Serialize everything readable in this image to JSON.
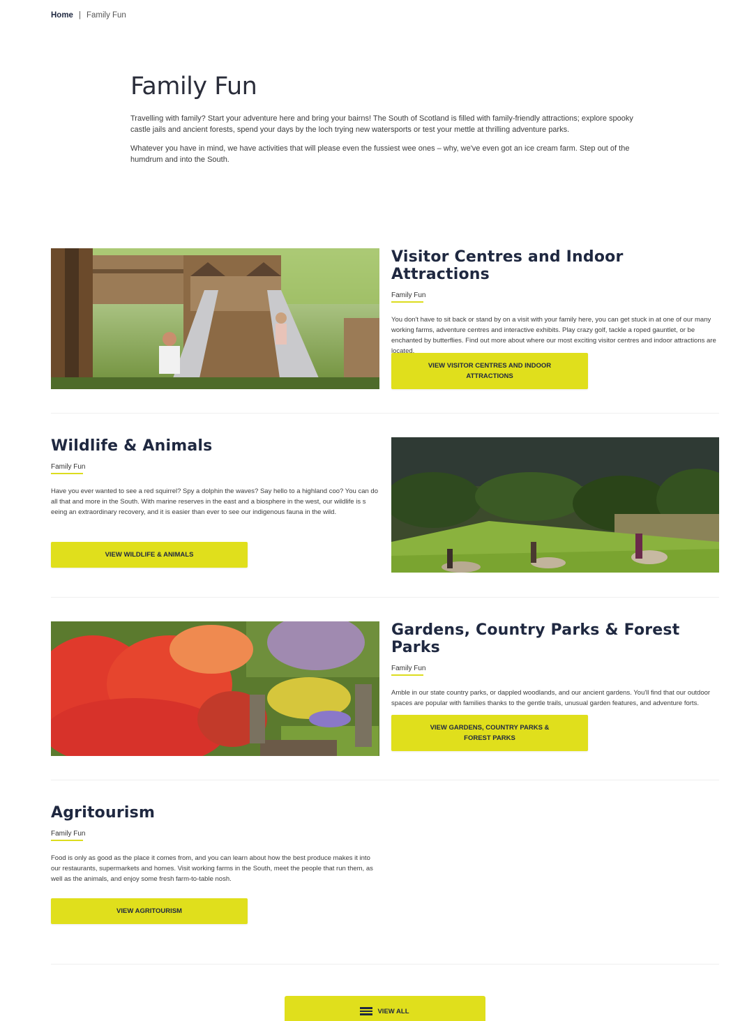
{
  "breadcrumb": {
    "home": "Home",
    "separator": "|",
    "current": "Family Fun"
  },
  "intro": {
    "title": "Family Fun",
    "paragraph1": "Travelling with family? Start your adventure here and bring your bairns! The South of Scotland is filled with family-friendly attractions; explore spooky castle jails and ancient forests, spend your days by the loch trying new watersports or test your mettle at thrilling adventure parks.",
    "paragraph2": "Whatever you have in mind, we have activities that will please even the fussiest wee ones – why, we've even got an ice cream farm. Step out of the humdrum and into the South."
  },
  "sections": [
    {
      "title": "Visitor Centres and Indoor Attractions",
      "tag": "Family Fun",
      "body": "You don't have to sit back or stand by on a visit with your family here, you can get stuck in at one of our many working farms, adventure centres and interactive exhibits. Play crazy golf, tackle a roped gauntlet, or be enchanted by butterflies. Find out more about where our most exciting visitor centres and indoor attractions are located.",
      "button": "View Visitor Centres and Indoor Attractions",
      "image": "treehouse-slides-photo"
    },
    {
      "title": "Wildlife & Animals",
      "tag": "Family Fun",
      "body": "Have you ever wanted to see a red squirrel? Spy a dolphin the waves? Say hello to a highland coo? You can do all that and more in the South. With marine reserves in the east and a biosphere in the west, our wildlife is s eeing an extraordinary recovery, and it is easier than ever to see our indigenous fauna in the wild.",
      "button": "View Wildlife & Animals",
      "image": "alpaca-walk-photo"
    },
    {
      "title": "Gardens, Country Parks & Forest Parks",
      "tag": "Family Fun",
      "body": "Amble in our state country parks, or dappled woodlands, and our ancient gardens. You'll find that our outdoor spaces are popular with families thanks to the gentle trails, unusual garden features, and adventure forts.",
      "button": "View Gardens, Country Parks & Forest Parks",
      "image": "azalea-garden-photo"
    },
    {
      "title": "Agritourism",
      "tag": "Family Fun",
      "body": "Food is only as good as the place it comes from, and you can learn about how the best produce makes it into our restaurants, supermarkets and homes. Visit working farms in the South, meet the people that run them, as well as the animals, and enjoy some fresh farm-to-table nosh.",
      "button": "View Agritourism"
    }
  ],
  "view_all": {
    "label": "View All",
    "icon": "list-icon"
  },
  "colors": {
    "accent": "#e0df1c",
    "heading": "#1f2840"
  }
}
